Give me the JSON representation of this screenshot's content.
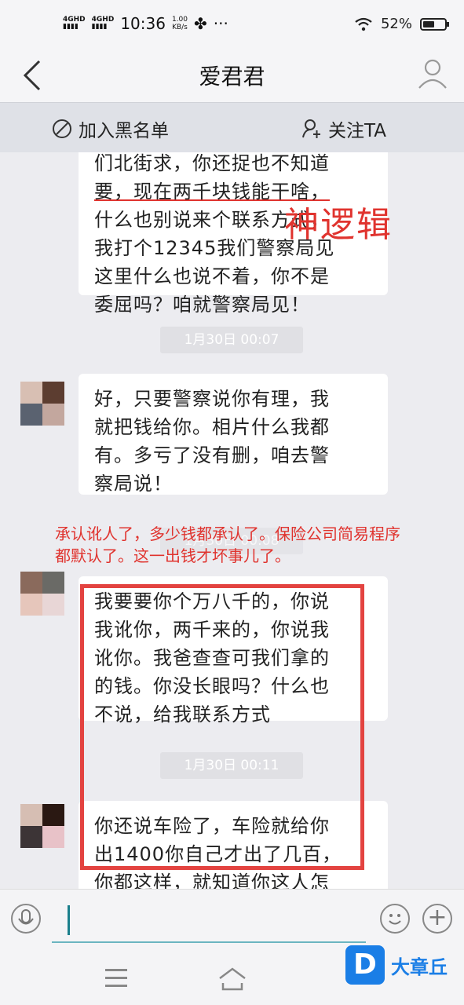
{
  "status_bar": {
    "network1": "4GHD",
    "network2": "4GHD",
    "time": "10:36",
    "speed_value": "1.00",
    "speed_unit": "KB/s",
    "more": "···",
    "battery": "52%",
    "battery_level": 0.52
  },
  "header": {
    "title": "爱君君",
    "back_glyph": "<"
  },
  "actions": {
    "blacklist": "加入黑名单",
    "follow": "关注TA"
  },
  "messages": [
    {
      "lines": [
        "们北街求，你还捉也不知道",
        "要，现在两千块钱能干啥，",
        "什么也别说来个联系方式，",
        "我打个12345我们警察局见",
        "这里什么也说不着，你不是",
        "委屈吗？咱就警察局见！"
      ]
    },
    {
      "time": "1月30日 00:07"
    },
    {
      "lines": [
        "好，只要警察说你有理，我",
        "就把钱给你。相片什么我都",
        "有。多亏了没有删，咱去警",
        "察局说！"
      ]
    },
    {
      "time": "1月30日 00:08"
    },
    {
      "lines": [
        "我要要你个万八千的，你说",
        "我讹你，两千来的，你说我",
        "讹你。我爸查查可我们拿的",
        "的钱。你没长眼吗？什么也",
        "不说，给我联系方式"
      ]
    },
    {
      "time": "1月30日 00:11"
    },
    {
      "lines": [
        "你还说车险了，车险就给你",
        "出1400你自己才出了几百，",
        "你都这样，就知道你这人怎"
      ]
    }
  ],
  "annotations": {
    "big": "神逻辑",
    "small": "承认讹人了，多少钱都承认了。保险公司简易程序都默认了。这一出钱才坏事儿了。"
  },
  "watermark": {
    "logo": "D",
    "text": "大章丘"
  },
  "colors": {
    "annotation_red": "#e0332e",
    "accent": "#1a7ee6",
    "bubble_bg": "#ffffff",
    "chat_bg": "#ececf0"
  }
}
